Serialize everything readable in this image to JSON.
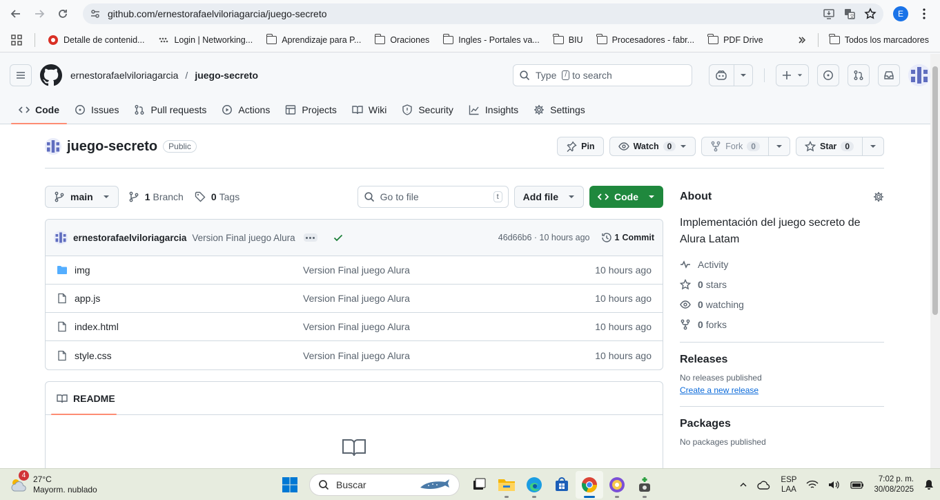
{
  "browser": {
    "url": "github.com/ernestorafaelviloriagarcia/juego-secreto",
    "profile_initial": "E",
    "bookmarks": [
      {
        "label": "Detalle de contenid...",
        "icon": "red-circle-icon"
      },
      {
        "label": "Login | Networking...",
        "icon": "dots-icon"
      },
      {
        "label": "Aprendizaje para P...",
        "icon": "folder-icon"
      },
      {
        "label": "Oraciones",
        "icon": "folder-icon"
      },
      {
        "label": "Ingles - Portales va...",
        "icon": "folder-icon"
      },
      {
        "label": "BIU",
        "icon": "folder-icon"
      },
      {
        "label": "Procesadores - fabr...",
        "icon": "folder-icon"
      },
      {
        "label": "PDF Drive",
        "icon": "folder-icon"
      }
    ],
    "all_bookmarks": "Todos los marcadores"
  },
  "github": {
    "owner": "ernestorafaelviloriagarcia",
    "repo": "juego-secreto",
    "search_placeholder_pre": "Type",
    "search_key": "/",
    "search_placeholder_post": "to search",
    "tabs": [
      "Code",
      "Issues",
      "Pull requests",
      "Actions",
      "Projects",
      "Wiki",
      "Security",
      "Insights",
      "Settings"
    ],
    "visibility": "Public",
    "pin_label": "Pin",
    "watch_label": "Watch",
    "watch_count": "0",
    "fork_label": "Fork",
    "fork_count": "0",
    "star_label": "Star",
    "star_count": "0",
    "branch": "main",
    "branches_count": "1",
    "branches_label": "Branch",
    "tags_count": "0",
    "tags_label": "Tags",
    "goto_placeholder": "Go to file",
    "goto_key": "t",
    "add_file": "Add file",
    "code_button": "Code",
    "commit": {
      "author": "ernestorafaelviloriagarcia",
      "message": "Version Final juego Alura",
      "hash_time": "46d66b6 · 10 hours ago",
      "commits_count": "1",
      "commits_label": "Commit"
    },
    "files": [
      {
        "name": "img",
        "type": "folder",
        "message": "Version Final juego Alura",
        "age": "10 hours ago"
      },
      {
        "name": "app.js",
        "type": "file",
        "message": "Version Final juego Alura",
        "age": "10 hours ago"
      },
      {
        "name": "index.html",
        "type": "file",
        "message": "Version Final juego Alura",
        "age": "10 hours ago"
      },
      {
        "name": "style.css",
        "type": "file",
        "message": "Version Final juego Alura",
        "age": "10 hours ago"
      }
    ],
    "readme_label": "README",
    "about": {
      "title": "About",
      "description": "Implementación del juego secreto de Alura Latam",
      "activity": "Activity",
      "stars_count": "0",
      "stars_label": "stars",
      "watching_count": "0",
      "watching_label": "watching",
      "forks_count": "0",
      "forks_label": "forks"
    },
    "releases": {
      "title": "Releases",
      "none": "No releases published",
      "create_link": "Create a new release"
    },
    "packages": {
      "title": "Packages",
      "none": "No packages published"
    }
  },
  "taskbar": {
    "weather_temp": "27°C",
    "weather_desc": "Mayorm. nublado",
    "weather_badge": "4",
    "search_label": "Buscar",
    "lang_1": "ESP",
    "lang_2": "LAA",
    "time": "7:02 p. m.",
    "date": "30/08/2025"
  },
  "colors": {
    "accent_green": "#1f883d",
    "tab_underline": "#fd8c73",
    "link_blue": "#0969da"
  }
}
